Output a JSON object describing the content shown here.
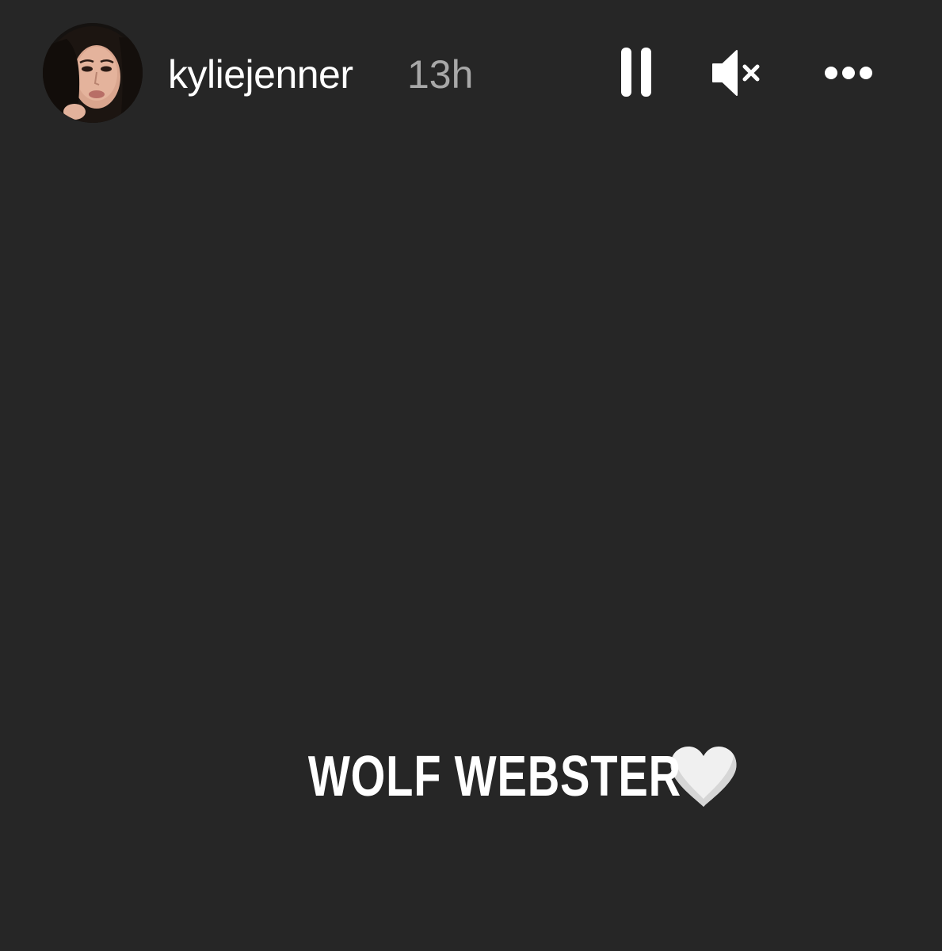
{
  "story": {
    "username": "kyliejenner",
    "timestamp": "13h",
    "caption": "WOLF WEBSTER",
    "caption_emoji": "white-heart-icon"
  },
  "controls": {
    "pause_icon": "pause-icon",
    "mute_icon": "speaker-muted-icon",
    "more_icon": "more-options-icon"
  },
  "colors": {
    "background": "#262626",
    "text": "#ffffff",
    "timestamp": "#a8a8a8",
    "heart": "#f0f0f0"
  }
}
